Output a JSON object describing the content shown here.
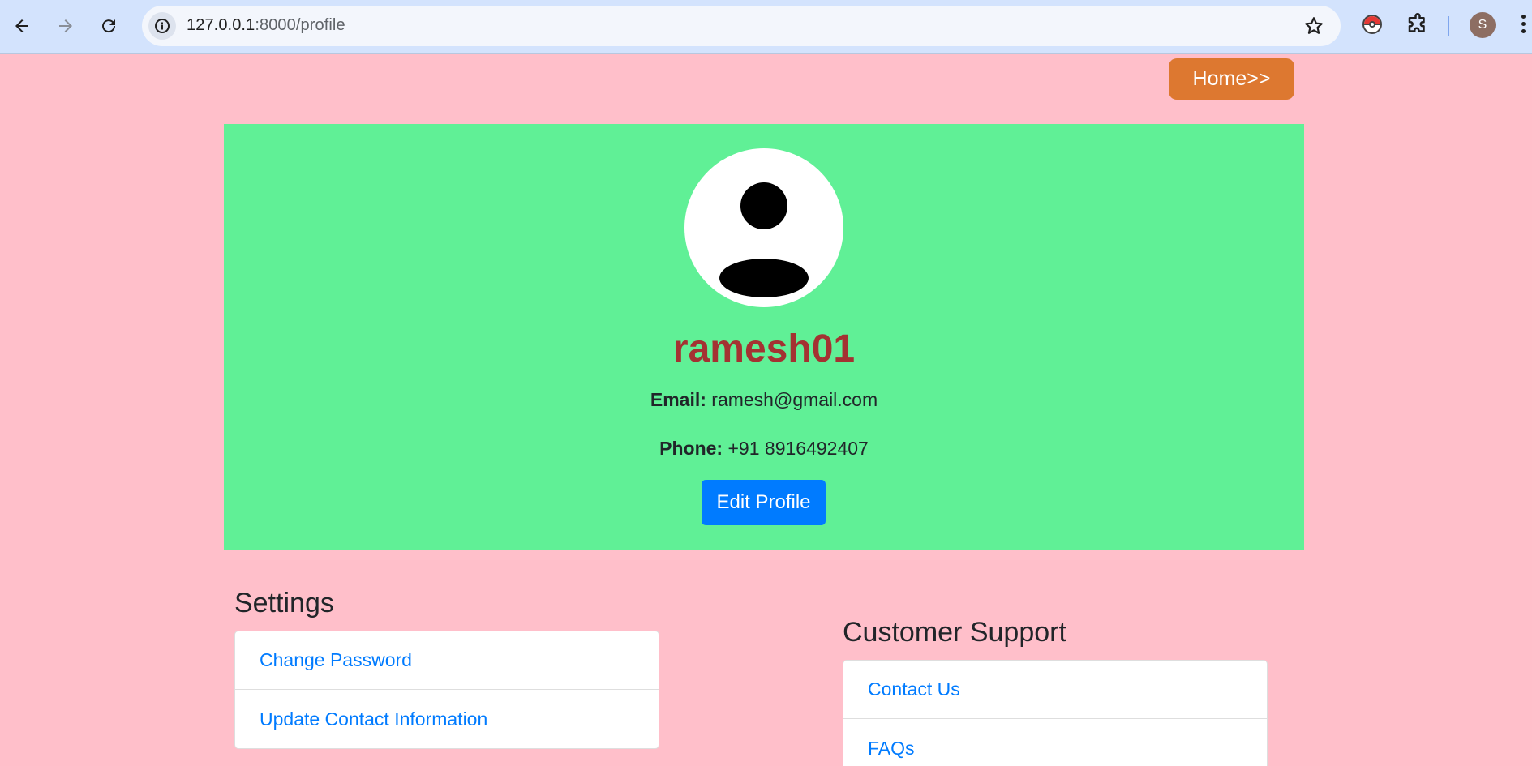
{
  "browser": {
    "url_host": "127.0.0.1",
    "url_path": ":8000/profile",
    "profile_initial": "S"
  },
  "nav": {
    "home_label": "Home>>"
  },
  "profile": {
    "username": "ramesh01",
    "email_label": "Email:",
    "email": "ramesh@gmail.com",
    "phone_label": "Phone:",
    "phone": "+91 8916492407",
    "edit_label": "Edit Profile"
  },
  "settings": {
    "title": "Settings",
    "items": [
      "Change Password",
      "Update Contact Information"
    ]
  },
  "support": {
    "title": "Customer Support",
    "items": [
      "Contact Us",
      "FAQs"
    ]
  },
  "colors": {
    "page_bg": "#ffbfca",
    "card_bg": "#60f096",
    "home_button": "#dd7830",
    "username": "#a43232",
    "primary": "#007bff"
  }
}
